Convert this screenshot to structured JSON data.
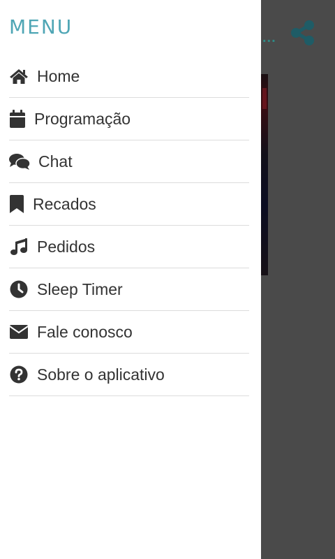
{
  "drawer": {
    "title": "MENU",
    "items": [
      {
        "label": "Home",
        "icon": "home-icon"
      },
      {
        "label": "Programação",
        "icon": "calendar-icon"
      },
      {
        "label": "Chat",
        "icon": "chat-icon"
      },
      {
        "label": "Recados",
        "icon": "bookmark-icon"
      },
      {
        "label": "Pedidos",
        "icon": "music-icon"
      },
      {
        "label": "Sleep Timer",
        "icon": "clock-icon"
      },
      {
        "label": "Fale conosco",
        "icon": "envelope-icon"
      },
      {
        "label": "Sobre o aplicativo",
        "icon": "question-circle-icon"
      }
    ]
  },
  "background_app": {
    "truncated_title": "...",
    "share_icon": "share-icon"
  },
  "colors": {
    "accent": "#4fa6b5",
    "overlay": "#4a4a4a",
    "icon": "#333333",
    "share": "#1f5c66"
  }
}
